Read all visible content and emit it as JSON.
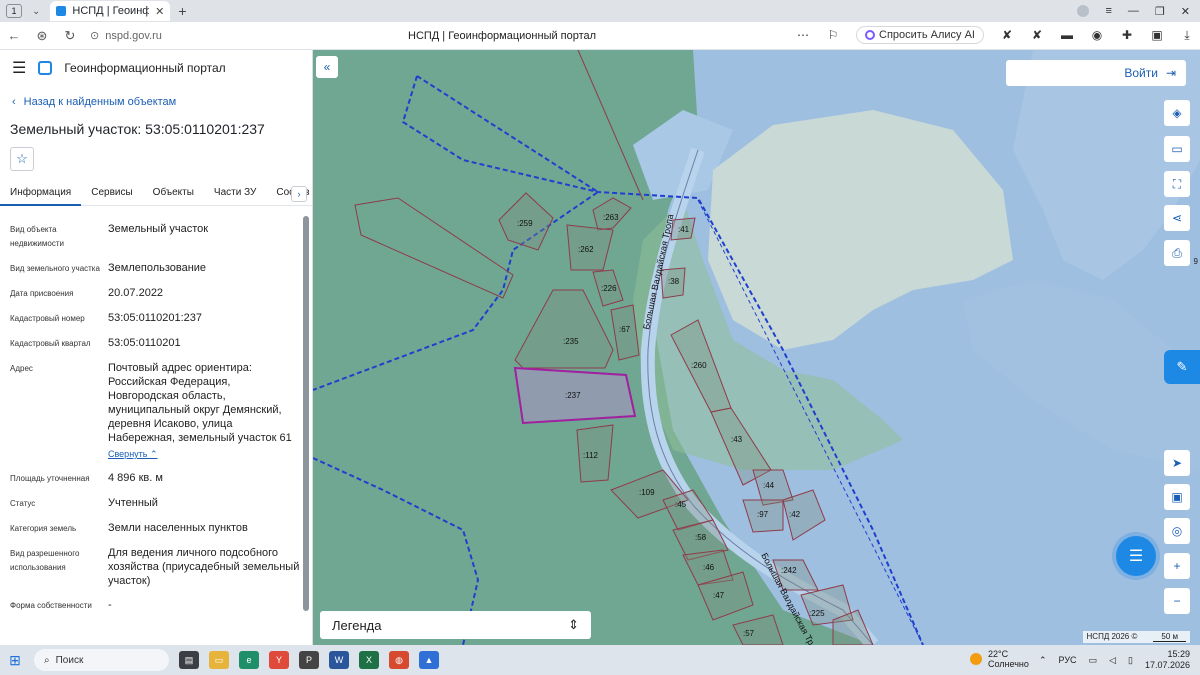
{
  "browser": {
    "tab_count": "1",
    "tab_title": "НСПД | Геоинформационны",
    "url": "nspd.gov.ru",
    "page_title": "НСПД | Геоинформационный портал",
    "alice_label": "Спросить Алису AI"
  },
  "sidebar": {
    "portal_name": "Геоинформационный портал",
    "back_link": "Назад к найденным объектам",
    "object_title": "Земельный участок: 53:05:0110201:237",
    "tabs": [
      {
        "label": "Информация",
        "active": true
      },
      {
        "label": "Сервисы"
      },
      {
        "label": "Объекты"
      },
      {
        "label": "Части ЗУ"
      },
      {
        "label": "Состав"
      }
    ],
    "properties": [
      {
        "label": "Вид объекта недвижимости",
        "value": "Земельный участок"
      },
      {
        "label": "Вид земельного участка",
        "value": "Землепользование"
      },
      {
        "label": "Дата присвоения",
        "value": "20.07.2022"
      },
      {
        "label": "Кадастровый номер",
        "value": "53:05:0110201:237"
      },
      {
        "label": "Кадастровый квартал",
        "value": "53:05:0110201"
      },
      {
        "label": "Адрес",
        "value": "Почтовый адрес ориентира: Российская Федерация, Новгородская область, муниципальный округ Демянский, деревня Исаково, улица Набережная, земельный участок 61"
      },
      {
        "label": "Площадь уточненная",
        "value": "4 896 кв. м"
      },
      {
        "label": "Статус",
        "value": "Учтенный"
      },
      {
        "label": "Категория земель",
        "value": "Земли населенных пунктов"
      },
      {
        "label": "Вид разрешенного использования",
        "value": "Для ведения личного подсобного хозяйства (приусадебный земельный участок)"
      },
      {
        "label": "Форма собственности",
        "value": "-"
      }
    ],
    "collapse_label": "Свернуть"
  },
  "map": {
    "login_label": "Войти",
    "legend_label": "Легенда",
    "copyright": "НСПД 2026 ©",
    "scale": "50 м",
    "edge_label": "9",
    "road_name": "Большая Валдайская Тропа",
    "road_name_short": "Большая Валдайская Тр",
    "parcels": [
      ":259",
      ":263",
      ":262",
      ":41",
      ":226",
      ":38",
      ":67",
      ":235",
      ":237",
      ":260",
      ":112",
      ":43",
      ":109",
      ":44",
      ":45",
      ":97",
      ":42",
      ":58",
      ":242",
      ":46",
      ":47",
      ":225",
      ":57"
    ],
    "colors": {
      "water": "#9ebfe0",
      "land": "#6fa792",
      "selected": "#a020a0",
      "parcel_border": "#8e3b4b",
      "boundary": "#1f3fd0"
    }
  },
  "taskbar": {
    "search_label": "Поиск",
    "temperature": "22°C",
    "weather": "Солнечно",
    "language": "РУС",
    "time": "15:29",
    "date": "17.07.2026"
  }
}
